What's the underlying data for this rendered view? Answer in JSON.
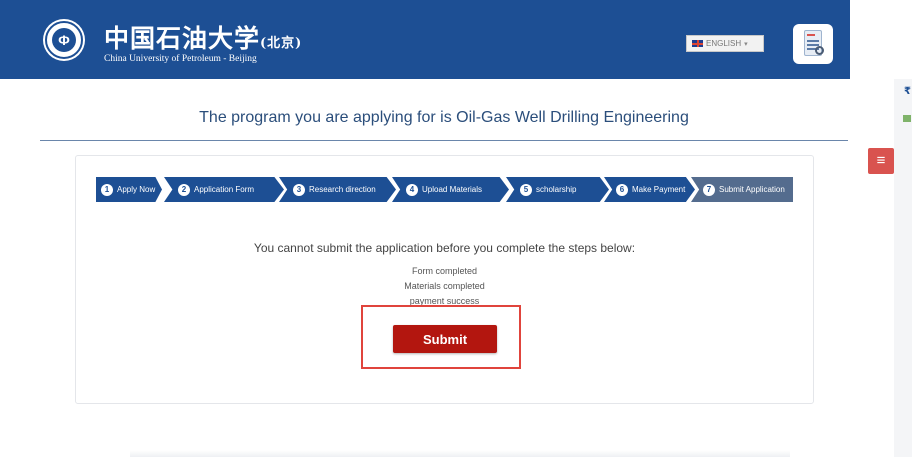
{
  "header": {
    "logo_cn_main": "中国石油大学",
    "logo_cn_sub": "(北京)",
    "logo_en": "China University of Petroleum - Beijing",
    "seal_glyph": "Φ",
    "language_label": "ENGLISH",
    "language_caret": "▾",
    "brand_color": "#1d4f94"
  },
  "right_panel": {
    "menu_icon": "≡",
    "edge_glyph": "₹"
  },
  "main": {
    "program_title": "The program you are applying for is Oil-Gas Well Drilling Engineering"
  },
  "steps": [
    {
      "num": "1",
      "label": "Apply Now"
    },
    {
      "num": "2",
      "label": "Application Form"
    },
    {
      "num": "3",
      "label": "Research direction"
    },
    {
      "num": "4",
      "label": "Upload Materials"
    },
    {
      "num": "5",
      "label": "scholarship"
    },
    {
      "num": "6",
      "label": "Make Payment"
    },
    {
      "num": "7",
      "label": "Submit Application"
    }
  ],
  "submit_section": {
    "message": "You cannot submit the application before you complete the steps below:",
    "requirements": [
      "Form completed",
      "Materials completed",
      "payment success"
    ],
    "submit_label": "Submit",
    "accent_color": "#b3160f"
  }
}
